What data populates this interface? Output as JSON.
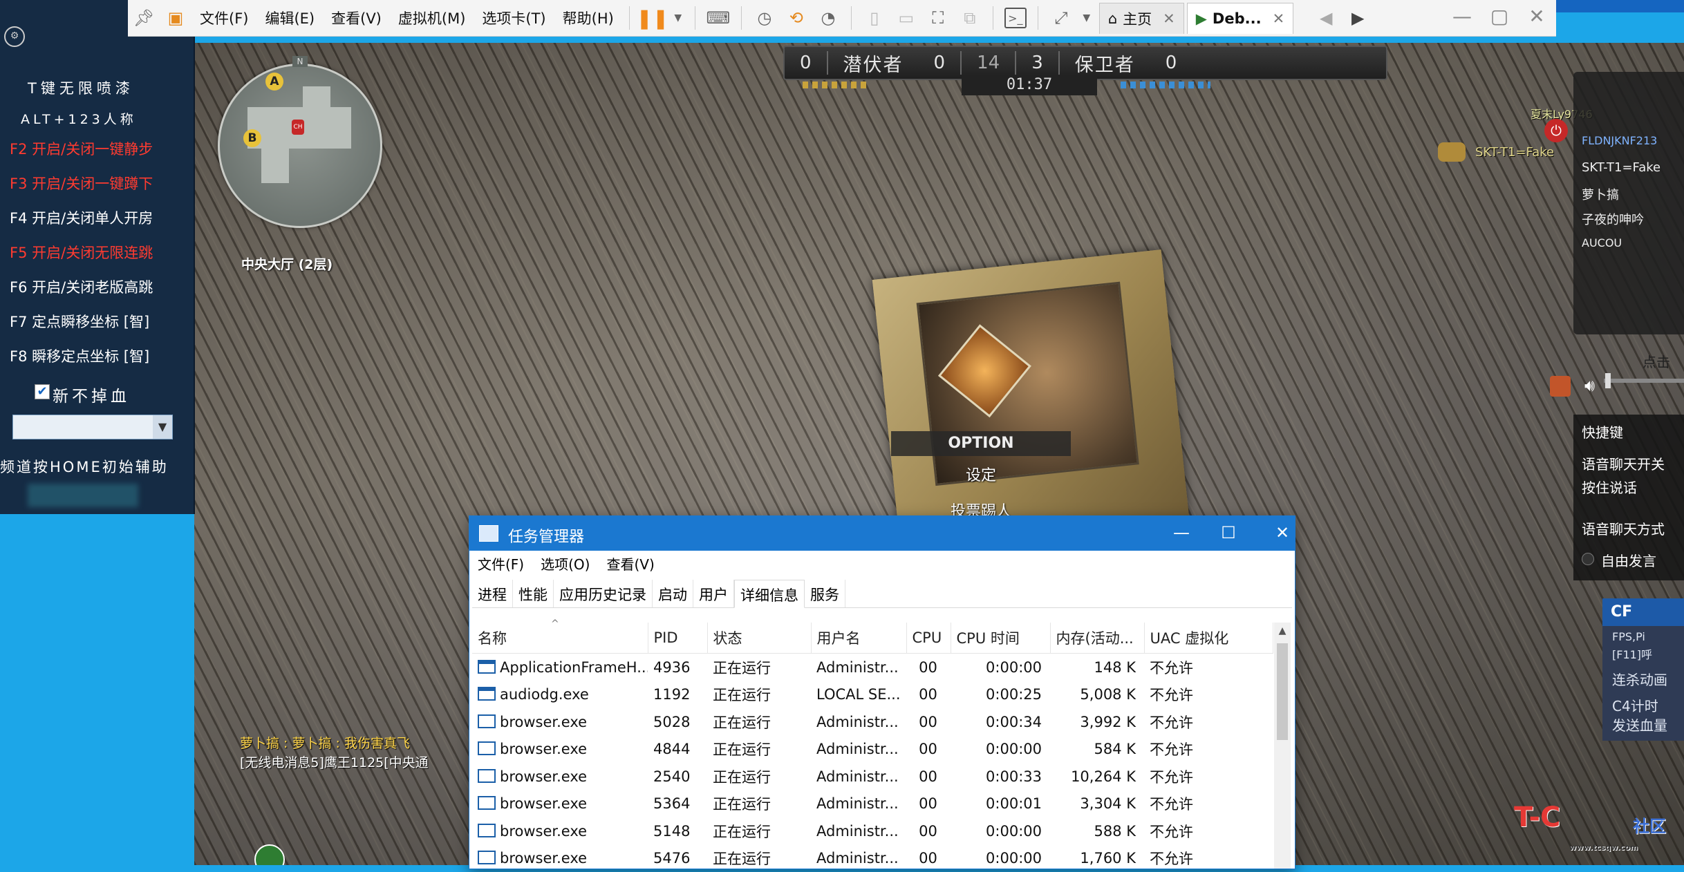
{
  "toolbar": {
    "menus": [
      "文件(F)",
      "编辑(E)",
      "查看(V)",
      "虚拟机(M)",
      "选项卡(T)",
      "帮助(H)"
    ],
    "tabs": [
      {
        "label": "主页",
        "icon": "home-icon"
      },
      {
        "label": "Deb...",
        "icon": "vm-icon"
      }
    ]
  },
  "cheat_panel": {
    "rows": [
      {
        "text": "T键无限喷漆",
        "color": "white"
      },
      {
        "text": "ALT+123人称",
        "color": "white"
      },
      {
        "text": "F2 开启/关闭一键静步",
        "color": "red"
      },
      {
        "text": "F3 开启/关闭一键蹲下",
        "color": "red"
      },
      {
        "text": "F4 开启/关闭单人开房",
        "color": "white"
      },
      {
        "text": "F5 开启/关闭无限连跳",
        "color": "red"
      },
      {
        "text": "F6 开启/关闭老版高跳",
        "color": "white"
      },
      {
        "text": "F7 定点瞬移坐标 [智]",
        "color": "white"
      },
      {
        "text": "F8 瞬移定点坐标 [智]",
        "color": "white"
      }
    ],
    "no_blood_label": "新不掉血",
    "no_blood_checked": true,
    "home_hint": "频道按HOME初始辅助"
  },
  "game": {
    "minimap": {
      "marker_a": "A",
      "marker_b": "B",
      "north": "N",
      "player": "CH"
    },
    "location": "中央大厅 (2层)",
    "scoreboard": {
      "left_score": "0",
      "left_team": "潜伏者",
      "left_kills": "0",
      "round": "14",
      "right_kills": "3",
      "right_team": "保卫者",
      "right_score": "0",
      "time": "01:37"
    },
    "option_menu": {
      "header": "OPTION",
      "items": [
        "设定",
        "投票踢人"
      ]
    },
    "chat": [
      "萝卜搞 : 萝卜搞 : 我伤害真飞",
      "[无线电消息5]鹰王1125[中央通"
    ],
    "enemy_name": "夏末Ly9746",
    "rank_name": "SKT-T1=Fake",
    "player_list": [
      "FLDNJKNF213",
      "SKT-T1=Fake",
      "萝卜搞",
      "子夜的呻吟",
      "AUCOU"
    ],
    "click_hint": "点击",
    "hotkeys": {
      "title": "快捷键",
      "voice_toggle": "语音聊天开关",
      "push_to_talk": "按住说话",
      "voice_mode": "语音聊天方式",
      "free_talk": "自由发言"
    },
    "cf_box": {
      "title": "CF",
      "lines": [
        "FPS,Pi",
        "[F11]呼",
        "连杀动画",
        "C4计时",
        "发送血量"
      ]
    },
    "watermark": {
      "brand": "T-C",
      "suffix": "社区",
      "url": "www.tcsqw.com"
    }
  },
  "task_manager": {
    "title": "任务管理器",
    "menu": [
      "文件(F)",
      "选项(O)",
      "查看(V)"
    ],
    "tabs": [
      "进程",
      "性能",
      "应用历史记录",
      "启动",
      "用户",
      "详细信息",
      "服务"
    ],
    "active_tab": "详细信息",
    "columns": [
      "名称",
      "PID",
      "状态",
      "用户名",
      "CPU",
      "CPU 时间",
      "内存(活动...",
      "UAC 虚拟化"
    ],
    "rows": [
      {
        "name": "ApplicationFrameH...",
        "pid": "4936",
        "status": "正在运行",
        "user": "Administr...",
        "cpu": "00",
        "cpu_time": "0:00:00",
        "mem": "148 K",
        "uac": "不允许",
        "icon": "app"
      },
      {
        "name": "audiodg.exe",
        "pid": "1192",
        "status": "正在运行",
        "user": "LOCAL SE...",
        "cpu": "00",
        "cpu_time": "0:00:25",
        "mem": "5,008 K",
        "uac": "不允许",
        "icon": "app"
      },
      {
        "name": "browser.exe",
        "pid": "5028",
        "status": "正在运行",
        "user": "Administr...",
        "cpu": "00",
        "cpu_time": "0:00:34",
        "mem": "3,992 K",
        "uac": "不允许",
        "icon": "window"
      },
      {
        "name": "browser.exe",
        "pid": "4844",
        "status": "正在运行",
        "user": "Administr...",
        "cpu": "00",
        "cpu_time": "0:00:00",
        "mem": "584 K",
        "uac": "不允许",
        "icon": "window"
      },
      {
        "name": "browser.exe",
        "pid": "2540",
        "status": "正在运行",
        "user": "Administr...",
        "cpu": "00",
        "cpu_time": "0:00:33",
        "mem": "10,264 K",
        "uac": "不允许",
        "icon": "window"
      },
      {
        "name": "browser.exe",
        "pid": "5364",
        "status": "正在运行",
        "user": "Administr...",
        "cpu": "00",
        "cpu_time": "0:00:01",
        "mem": "3,304 K",
        "uac": "不允许",
        "icon": "window"
      },
      {
        "name": "browser.exe",
        "pid": "5148",
        "status": "正在运行",
        "user": "Administr...",
        "cpu": "00",
        "cpu_time": "0:00:00",
        "mem": "588 K",
        "uac": "不允许",
        "icon": "window"
      },
      {
        "name": "browser.exe",
        "pid": "5476",
        "status": "正在运行",
        "user": "Administr...",
        "cpu": "00",
        "cpu_time": "0:00:00",
        "mem": "1,760 K",
        "uac": "不允许",
        "icon": "window"
      }
    ]
  }
}
